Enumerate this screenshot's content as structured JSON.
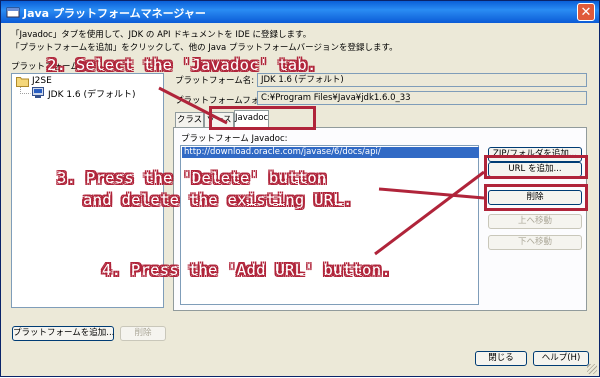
{
  "window": {
    "title": "Java プラットフォームマネージャー",
    "close_symbol": "✕"
  },
  "description": {
    "line1": "「Javadoc」タブを使用して、JDK の API ドキュメントを IDE に登録します。",
    "line2": "「プラットフォームを追加」をクリックして、他の Java プラットフォームバージョンを登録します。"
  },
  "tree": {
    "label": "プラットフォーム(P):",
    "root": "J2SE",
    "child": "JDK 1.6 (デフォルト)"
  },
  "fields": {
    "name_label": "プラットフォーム名:",
    "name_value": "JDK 1.6 (デフォルト)",
    "folder_label": "プラットフォームフォルダ:",
    "folder_value": "C:¥Program Files¥Java¥jdk1.6.0_33"
  },
  "tabs": [
    {
      "label": "クラス"
    },
    {
      "label": "ソース"
    },
    {
      "label": "Javadoc"
    }
  ],
  "javadoc": {
    "label": "プラットフォーム Javadoc:",
    "urls": [
      "http://download.oracle.com/javase/6/docs/api/"
    ],
    "buttons": {
      "add_zip": "ZIP/フォルダを追加...",
      "add_url": "URL を追加...",
      "delete": "削除",
      "move_up": "上へ移動",
      "move_down": "下へ移動"
    }
  },
  "footer": {
    "add_platform": "プラットフォームを追加...",
    "remove": "削除",
    "close": "閉じる",
    "help": "ヘルプ(H)"
  },
  "annotations": {
    "step2": "2. Select the 'Javadoc' tab.",
    "step3_line1": "3. Press the 'Delete' button",
    "step3_line2": "and delete the existing URL.",
    "step4": "4. Press the 'Add URL' button."
  },
  "colors": {
    "annotation": "#b0243a",
    "titlebar": "#0a5fd8",
    "selection": "#316ac5"
  }
}
